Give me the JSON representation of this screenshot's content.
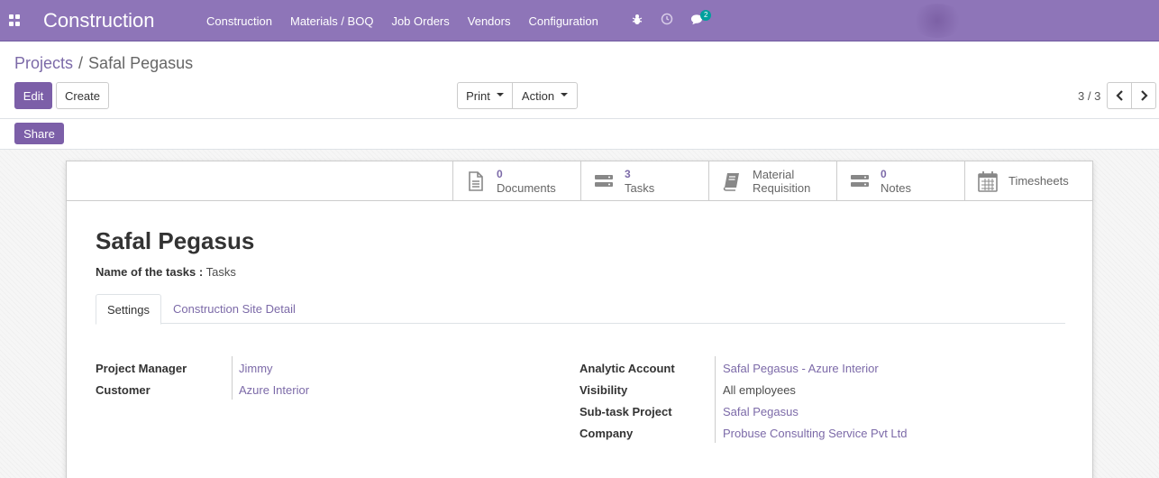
{
  "navbar": {
    "brand": "Construction",
    "menu": [
      "Construction",
      "Materials / BOQ",
      "Job Orders",
      "Vendors",
      "Configuration"
    ],
    "chat_badge": "2",
    "bg_color": "#8e75b8"
  },
  "breadcrumb": {
    "parent": "Projects",
    "separator": "/",
    "current": "Safal Pegasus"
  },
  "buttons": {
    "edit": "Edit",
    "create": "Create",
    "print": "Print",
    "action": "Action",
    "share": "Share"
  },
  "pager": {
    "value": "3 / 3"
  },
  "stat_buttons": [
    {
      "icon": "document-icon",
      "count": "0",
      "label": "Documents"
    },
    {
      "icon": "tasks-icon",
      "count": "3",
      "label": "Tasks"
    },
    {
      "icon": "book-icon",
      "count": "",
      "label_line1": "Material",
      "label_line2": "Requisition"
    },
    {
      "icon": "notes-icon",
      "count": "0",
      "label": "Notes"
    },
    {
      "icon": "calendar-icon",
      "count": "",
      "label": "Timesheets"
    }
  ],
  "record": {
    "title": "Safal Pegasus",
    "tasks_name_label": "Name of the tasks :",
    "tasks_name_value": "Tasks"
  },
  "tabs": {
    "settings": "Settings",
    "site_detail": "Construction Site Detail"
  },
  "left_fields": [
    {
      "label": "Project Manager",
      "value": "Jimmy",
      "link": true
    },
    {
      "label": "Customer",
      "value": "Azure Interior",
      "link": true
    }
  ],
  "right_fields": [
    {
      "label": "Analytic Account",
      "value": "Safal Pegasus - Azure Interior",
      "link": true
    },
    {
      "label": "Visibility",
      "value": "All employees",
      "link": false
    },
    {
      "label": "Sub-task Project",
      "value": "Safal Pegasus",
      "link": true
    },
    {
      "label": "Company",
      "value": "Probuse Consulting Service Pvt Ltd",
      "link": true
    }
  ],
  "colors": {
    "primary": "#7c5fa8",
    "link": "#7c6aa8",
    "badge": "#00a09d"
  }
}
